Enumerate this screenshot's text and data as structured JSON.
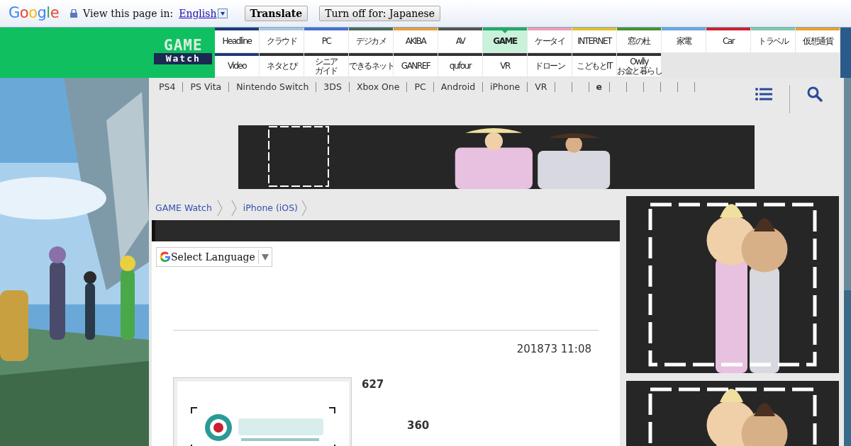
{
  "translate_bar": {
    "logo": "Google",
    "prompt": "View this page in:",
    "language": "English",
    "translate_button": "Translate",
    "turn_off_button": "Turn off for: Japanese"
  },
  "site_logo": {
    "top": "GAME",
    "bottom": "Watch"
  },
  "nav_tabs_top": [
    {
      "label": "Headline",
      "color": "#1f3a7a",
      "selected": false
    },
    {
      "label": "クラウド",
      "color": "#a8c4e0",
      "selected": false
    },
    {
      "label": "PC",
      "color": "#4a6fd0",
      "selected": false
    },
    {
      "label": "デジカメ",
      "color": "#4a6a5a",
      "selected": false
    },
    {
      "label": "AKIBA",
      "color": "#e0a040",
      "selected": false
    },
    {
      "label": "AV",
      "color": "#555555",
      "selected": false
    },
    {
      "label": "GAME",
      "color": "#22aa66",
      "selected": true
    },
    {
      "label": "ケータイ",
      "color": "#e8a0b8",
      "selected": false
    },
    {
      "label": "INTERNET",
      "color": "#e0c030",
      "selected": false
    },
    {
      "label": "窓の杜",
      "color": "#4a9030",
      "selected": false
    },
    {
      "label": "家電",
      "color": "#6aa8e0",
      "selected": false
    },
    {
      "label": "Car",
      "color": "#d02030",
      "selected": false
    },
    {
      "label": "トラベル",
      "color": "#80c8b0",
      "selected": false
    },
    {
      "label": "仮想通貨",
      "color": "#e8a030",
      "selected": false
    }
  ],
  "nav_tabs_bottom": [
    {
      "label": "Video",
      "color": "#1f3a7a",
      "selected": false
    },
    {
      "label": "ネタとぴ",
      "color": "#333333",
      "selected": false
    },
    {
      "label": "シニア",
      "label_line_2": "ガイド",
      "color": "#333333",
      "selected": false
    },
    {
      "label": "できるネット",
      "color": "#333333",
      "selected": false
    },
    {
      "label": "GANREF",
      "color": "#333333",
      "selected": false
    },
    {
      "label": "qufour",
      "color": "#333333",
      "selected": false
    },
    {
      "label": "VR",
      "color": "#333333",
      "selected": false
    },
    {
      "label": "ドローン",
      "color": "#333333",
      "selected": false
    },
    {
      "label": "こどもとIT",
      "color": "#333333",
      "selected": false
    },
    {
      "label": "Owlly",
      "label_line_2": "お金と暮らし",
      "color": "#333333",
      "selected": false
    }
  ],
  "subnav": [
    {
      "kind": "link",
      "label": "PS4"
    },
    {
      "kind": "link",
      "label": "PS Vita"
    },
    {
      "kind": "link",
      "label": "Nintendo Switch"
    },
    {
      "kind": "link",
      "label": "3DS"
    },
    {
      "kind": "link",
      "label": "Xbox One"
    },
    {
      "kind": "link",
      "label": "PC"
    },
    {
      "kind": "link",
      "label": "Android"
    },
    {
      "kind": "link",
      "label": "iPhone"
    },
    {
      "kind": "link",
      "label": "VR"
    },
    {
      "kind": "blank"
    },
    {
      "kind": "blank"
    },
    {
      "kind": "bold",
      "label": "e"
    },
    {
      "kind": "blank"
    },
    {
      "kind": "blank"
    },
    {
      "kind": "blank"
    },
    {
      "kind": "blank"
    }
  ],
  "breadcrumb": [
    "GAME Watch",
    "iPhone (iOS)"
  ],
  "language_select": {
    "label": "Select Language"
  },
  "article": {
    "date": "201873 11:08",
    "stats": [
      "627",
      "360"
    ]
  }
}
